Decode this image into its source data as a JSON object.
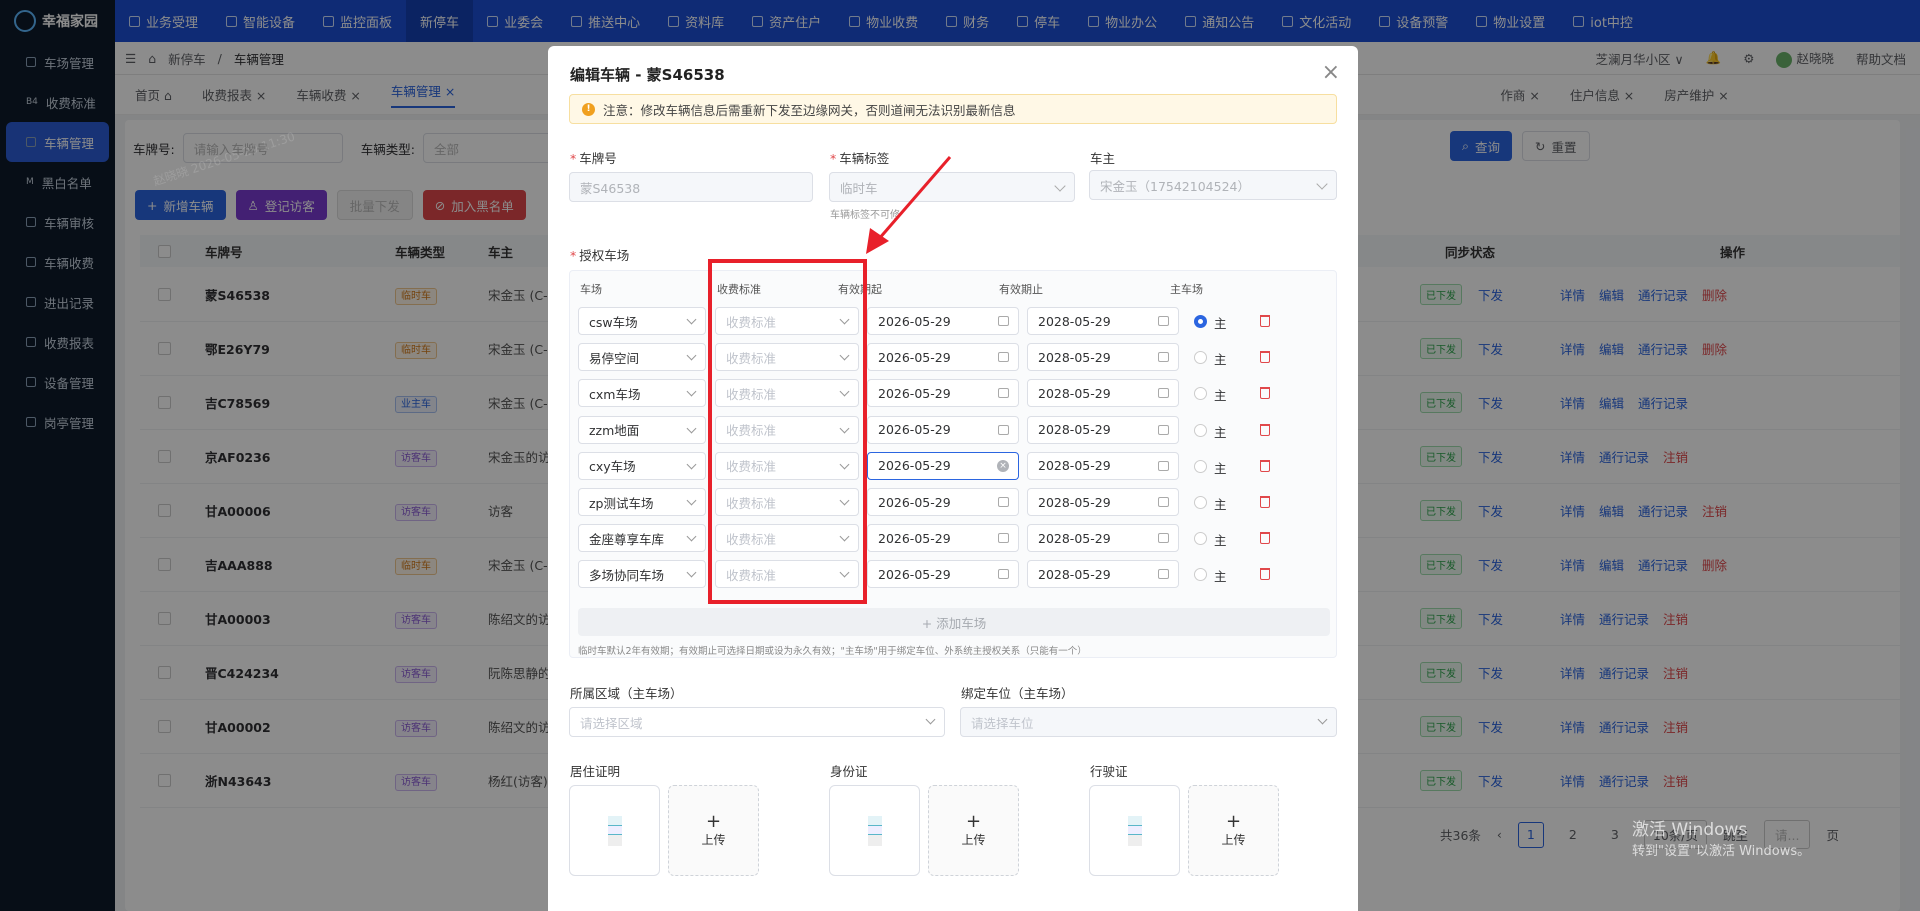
{
  "app": {
    "logo": "幸福家园"
  },
  "sidebar": {
    "items": [
      {
        "label": "车场管理",
        "icon": "gear-icon"
      },
      {
        "label": "收费标准",
        "icon": "b4-icon",
        "prefix": "B4"
      },
      {
        "label": "车辆管理",
        "icon": "car-icon",
        "active": true
      },
      {
        "label": "黑白名单",
        "icon": "m-icon",
        "prefix": "M"
      },
      {
        "label": "车辆审核",
        "icon": "audit-icon"
      },
      {
        "label": "车辆收费",
        "icon": "coin-icon"
      },
      {
        "label": "进出记录",
        "icon": "log-icon"
      },
      {
        "label": "收费报表",
        "icon": "report-icon"
      },
      {
        "label": "设备管理",
        "icon": "device-icon"
      },
      {
        "label": "岗亭管理",
        "icon": "booth-icon"
      }
    ]
  },
  "topnav": {
    "items": [
      {
        "label": "业务受理"
      },
      {
        "label": "智能设备"
      },
      {
        "label": "监控面板"
      },
      {
        "label": "新停车",
        "active": true
      },
      {
        "label": "业委会"
      },
      {
        "label": "推送中心"
      },
      {
        "label": "资料库"
      },
      {
        "label": "资产住户"
      },
      {
        "label": "物业收费"
      },
      {
        "label": "财务"
      },
      {
        "label": "停车"
      },
      {
        "label": "物业办公"
      },
      {
        "label": "通知公告"
      },
      {
        "label": "文化活动"
      },
      {
        "label": "设备预警"
      },
      {
        "label": "物业设置"
      },
      {
        "label": "iot中控"
      }
    ]
  },
  "breadcrumb": {
    "parent": "新停车",
    "current": "车辆管理",
    "community": "芝澜月华小区",
    "user": "赵晓晓",
    "help": "帮助文档"
  },
  "tabs": {
    "items": [
      {
        "label": "首页"
      },
      {
        "label": "收费报表"
      },
      {
        "label": "车辆收费"
      },
      {
        "label": "车辆管理",
        "active": true
      },
      {
        "label": "作商"
      },
      {
        "label": "住户信息"
      },
      {
        "label": "房产维护"
      }
    ]
  },
  "filter": {
    "plate_label": "车牌号:",
    "plate_placeholder": "请输入车牌号",
    "type_label": "车辆类型:",
    "type_value": "全部",
    "query": "查询",
    "reset": "重置"
  },
  "actions": {
    "add": "新增车辆",
    "visitor": "登记访客",
    "batch": "批量下发",
    "blacklist": "加入黑名单"
  },
  "table": {
    "headers": [
      "车牌号",
      "车辆类型",
      "车主",
      "同步状态",
      "操作"
    ],
    "rows": [
      {
        "plate": "蒙S46538",
        "type": "临时车",
        "tag": "t1",
        "owner": "宋金玉 (C-C",
        "sync": "已下发",
        "push": "下发",
        "ops": [
          "详情",
          "编辑",
          "通行记录",
          "删除"
        ]
      },
      {
        "plate": "鄂E26Y79",
        "type": "临时车",
        "tag": "t1",
        "owner": "宋金玉 (C-C",
        "sync": "已下发",
        "push": "下发",
        "ops": [
          "详情",
          "编辑",
          "通行记录",
          "删除"
        ]
      },
      {
        "plate": "吉C78569",
        "type": "业主车",
        "tag": "t3",
        "owner": "宋金玉 (C-C",
        "sync": "已下发",
        "push": "下发",
        "ops": [
          "详情",
          "编辑",
          "通行记录"
        ]
      },
      {
        "plate": "京AF0236",
        "type": "访客车",
        "tag": "t2",
        "owner": "宋金玉的访",
        "sync": "已下发",
        "push": "下发",
        "ops": [
          "详情",
          "通行记录",
          "注销"
        ]
      },
      {
        "plate": "甘A00006",
        "type": "访客车",
        "tag": "t2",
        "owner": "访客",
        "sync": "已下发",
        "push": "下发",
        "ops": [
          "详情",
          "编辑",
          "通行记录",
          "注销"
        ]
      },
      {
        "plate": "吉AAA888",
        "type": "临时车",
        "tag": "t1",
        "owner": "宋金玉 (C-C",
        "sync": "已下发",
        "push": "下发",
        "ops": [
          "详情",
          "编辑",
          "通行记录",
          "删除"
        ]
      },
      {
        "plate": "甘A00003",
        "type": "访客车",
        "tag": "t2",
        "owner": "陈绍文的访",
        "sync": "已下发",
        "push": "下发",
        "ops": [
          "详情",
          "通行记录",
          "注销"
        ]
      },
      {
        "plate": "晋C424234",
        "type": "访客车",
        "tag": "t2",
        "owner": "阮陈思静的",
        "sync": "已下发",
        "push": "下发",
        "ops": [
          "详情",
          "通行记录",
          "注销"
        ]
      },
      {
        "plate": "甘A00002",
        "type": "访客车",
        "tag": "t2",
        "owner": "陈绍文的访",
        "sync": "已下发",
        "push": "下发",
        "ops": [
          "详情",
          "通行记录",
          "注销"
        ]
      },
      {
        "plate": "浙N43643",
        "type": "访客车",
        "tag": "t2",
        "owner": "杨红(访客)",
        "sync": "已下发",
        "push": "下发",
        "ops": [
          "详情",
          "通行记录",
          "注销"
        ]
      }
    ]
  },
  "pagination": {
    "total": "共36条",
    "pages": [
      "1",
      "2",
      "3"
    ],
    "size": "10条/页",
    "goto": "跳至",
    "goto_placeholder": "请...",
    "page_unit": "页"
  },
  "modal": {
    "title": "编辑车辆 - 蒙S46538",
    "notice": "注意：修改车辆信息后需重新下发至边缘网关，否则道闸无法识别最新信息",
    "plate_label": "车牌号",
    "plate_value": "蒙S46538",
    "tag_label": "车辆标签",
    "tag_value": "临时车",
    "tag_hint": "车辆标签不可修",
    "owner_label": "车主",
    "owner_value": "宋金玉（17542104524）",
    "auth_label": "授权车场",
    "cols": [
      "车场",
      "收费标准",
      "有效期起",
      "有效期止",
      "主车场"
    ],
    "fee_placeholder": "收费标准",
    "main_label": "主",
    "parks": [
      {
        "name": "csw车场",
        "start": "2026-05-29",
        "end": "2028-05-29",
        "main": true
      },
      {
        "name": "易停空间",
        "start": "2026-05-29",
        "end": "2028-05-29",
        "main": false
      },
      {
        "name": "cxm车场",
        "start": "2026-05-29",
        "end": "2028-05-29",
        "main": false
      },
      {
        "name": "zzm地面",
        "start": "2026-05-29",
        "end": "2028-05-29",
        "main": false
      },
      {
        "name": "cxy车场",
        "start": "2026-05-29",
        "end": "2028-05-29",
        "main": false,
        "focus": true
      },
      {
        "name": "zp测试车场",
        "start": "2026-05-29",
        "end": "2028-05-29",
        "main": false
      },
      {
        "name": "金座尊享车库",
        "start": "2026-05-29",
        "end": "2028-05-29",
        "main": false
      },
      {
        "name": "多场协同车场",
        "start": "2026-05-29",
        "end": "2028-05-29",
        "main": false
      }
    ],
    "add_park": "+ 添加车场",
    "footnote": "临时车默认2年有效期；有效期止可选择日期或设为永久有效；\"主车场\"用于绑定车位、外系统主授权关系（只能有一个）",
    "area_label": "所属区域（主车场）",
    "area_placeholder": "请选择区域",
    "space_label": "绑定车位（主车场）",
    "space_placeholder": "请选择车位",
    "docs": [
      {
        "label": "居住证明"
      },
      {
        "label": "身份证"
      },
      {
        "label": "行驶证"
      }
    ],
    "upload": "上传"
  },
  "watermark": "赵晓晓 2026-05-29 11:30",
  "windows": {
    "line1": "激活 Windows",
    "line2": "转到\"设置\"以激活 Windows。"
  },
  "colors": {
    "primary": "#2b65e0",
    "nav": "#1c4fd6",
    "sidebar": "#0d1b2a",
    "highlight": "#e8202a"
  }
}
